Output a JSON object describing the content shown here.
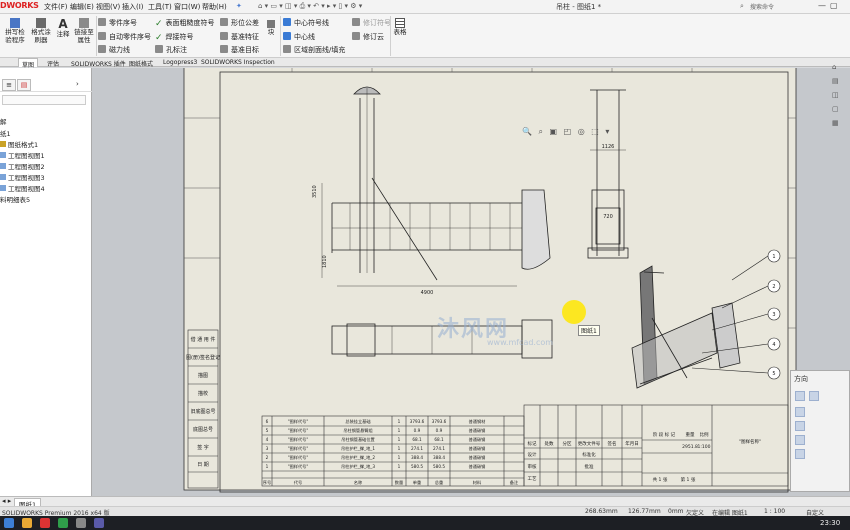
{
  "app": {
    "brand": "DWORKS",
    "menus": [
      "文件(F)",
      "编辑(E)",
      "视图(V)",
      "插入(I)",
      "工具(T)",
      "窗口(W)",
      "帮助(H)"
    ],
    "doc_title": "吊柱 - 图纸1 *",
    "search_placeholder": "搜索命令"
  },
  "ribbon": {
    "big_buttons": [
      {
        "label": "拼写检\n验程序"
      },
      {
        "label": "格式涂\n刷器"
      },
      {
        "label": "注释"
      },
      {
        "label": "链接至\n属性"
      }
    ],
    "col1": [
      "零件序号",
      "自动零件序号",
      "磁力线"
    ],
    "col2": [
      "表面粗糙度符号",
      "焊接符号",
      "孔标注"
    ],
    "col3": [
      "形位公差",
      "基准特征",
      "基准目标"
    ],
    "col4_header": "块",
    "col5": [
      "中心符号线",
      "中心线",
      "区域剖面线/填充"
    ],
    "col6": [
      "修订符号",
      "修订云"
    ],
    "table_label": "表格"
  },
  "tabs": [
    "草图",
    "评估",
    "SOLIDWORKS 插件",
    "图纸格式",
    "Logopress3",
    "SOLIDWORKS Inspection"
  ],
  "tabs_active_index": 0,
  "left_panel": {
    "tree": [
      {
        "label": "解",
        "indent": 0
      },
      {
        "label": "纸1",
        "indent": 0
      },
      {
        "label": "图纸格式1",
        "indent": 1
      },
      {
        "label": "工程图视图1",
        "indent": 1
      },
      {
        "label": "工程图视图2",
        "indent": 1
      },
      {
        "label": "工程图视图3",
        "indent": 1
      },
      {
        "label": "工程图视图4",
        "indent": 1
      },
      {
        "label": "料明细表5",
        "indent": 0
      }
    ]
  },
  "drawing": {
    "dimensions": [
      "1126",
      "720",
      "4900",
      "3510",
      "1810"
    ],
    "balloons": [
      "1",
      "2",
      "3",
      "4",
      "5"
    ],
    "left_column_labels": [
      "借 通 用 件",
      "图(册)签名登记",
      "描图",
      "描校",
      "旧底图总号",
      "底图总号",
      "签 字",
      "日 期"
    ],
    "bom_rows": [
      {
        "no": "6",
        "code": "\"图样代号\"",
        "name": "总装挂立基础",
        "qty": "1",
        "w1": "3793.6",
        "w2": "3793.6",
        "mat": "普通钢材"
      },
      {
        "no": "5",
        "code": "\"图样代号\"",
        "name": "吊柱钢管悬臂组",
        "qty": "1",
        "w1": "0.9",
        "w2": "0.9",
        "mat": "普通碳钢"
      },
      {
        "no": "4",
        "code": "\"图样代号\"",
        "name": "吊柱钢管基础位置",
        "qty": "1",
        "w1": "68.1",
        "w2": "68.1",
        "mat": "普通碳钢"
      },
      {
        "no": "3",
        "code": "\"图样代号\"",
        "name": "吊柱护栏_撑_地_1",
        "qty": "1",
        "w1": "274.1",
        "w2": "274.1",
        "mat": "普通碳钢"
      },
      {
        "no": "2",
        "code": "\"图样代号\"",
        "name": "吊柱护栏_撑_地_2",
        "qty": "1",
        "w1": "388.4",
        "w2": "388.4",
        "mat": "普通碳钢"
      },
      {
        "no": "1",
        "code": "\"图样代号\"",
        "name": "吊柱护栏_撑_地_3",
        "qty": "1",
        "w1": "580.5",
        "w2": "580.5",
        "mat": "普通碳钢"
      }
    ],
    "bom_header": [
      "序号",
      "代号",
      "名称",
      "数量",
      "单重",
      "总重",
      "材料",
      "备注"
    ],
    "title_block": {
      "drawing_name": "\"图样名称\"",
      "labels_top": [
        "阶 段 标 记",
        "重量",
        "比例"
      ],
      "scale": "1:100",
      "weight": "2951.8",
      "sheet": "共 1 张",
      "sheet_no": "第 1 张",
      "rev_headers": [
        "标记",
        "处数",
        "分区",
        "更改文件号",
        "签名",
        "年月日"
      ],
      "roles": [
        "设计",
        "审核",
        "工艺"
      ],
      "roles_right": [
        "标准化",
        "批准"
      ]
    },
    "tooltip": "图纸1",
    "watermark": "沐风网",
    "watermark_sub": "www.mfcad.com"
  },
  "task_pane": {
    "title": "方向"
  },
  "sheet_tabs": [
    "图纸1"
  ],
  "status": {
    "product": "SOLIDWORKS Premium 2016 x64 版",
    "x": "268.63mm",
    "y": "126.77mm",
    "z": "0mm",
    "defined": "欠定义",
    "editing": "在编辑 图纸1",
    "scale": "1 : 100",
    "units": "自定义"
  },
  "clock": "23:30"
}
